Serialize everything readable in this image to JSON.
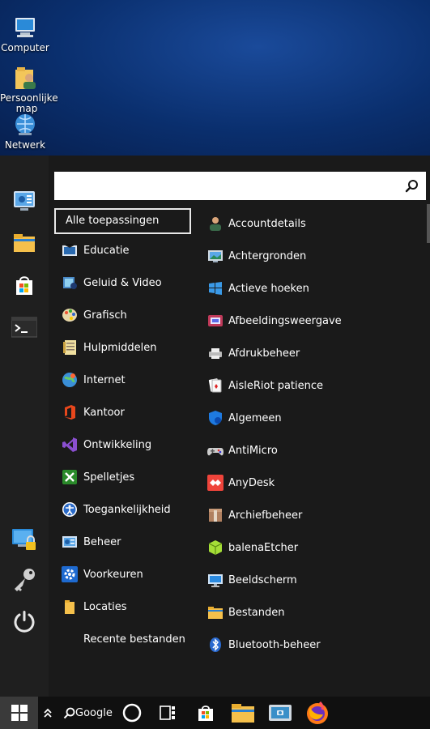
{
  "desktop": {
    "icons": [
      {
        "label": "Computer"
      },
      {
        "label": "Persoonlijke map"
      },
      {
        "label": "Netwerk"
      }
    ]
  },
  "menu": {
    "search": {
      "value": "",
      "placeholder": ""
    },
    "all_apps_label": "Alle toepassingen",
    "categories": [
      {
        "label": "Educatie",
        "icon": "education-icon"
      },
      {
        "label": "Geluid & Video",
        "icon": "sound-video-icon"
      },
      {
        "label": "Grafisch",
        "icon": "graphics-icon"
      },
      {
        "label": "Hulpmiddelen",
        "icon": "accessories-icon"
      },
      {
        "label": "Internet",
        "icon": "internet-icon"
      },
      {
        "label": "Kantoor",
        "icon": "office-icon"
      },
      {
        "label": "Ontwikkeling",
        "icon": "development-icon"
      },
      {
        "label": "Spelletjes",
        "icon": "games-icon"
      },
      {
        "label": "Toegankelijkheid",
        "icon": "accessibility-icon"
      },
      {
        "label": "Beheer",
        "icon": "administration-icon"
      },
      {
        "label": "Voorkeuren",
        "icon": "preferences-icon"
      },
      {
        "label": "Locaties",
        "icon": "places-icon"
      },
      {
        "label": "Recente bestanden",
        "icon": ""
      }
    ],
    "apps": [
      {
        "label": "Accountdetails",
        "icon": "user-account-icon"
      },
      {
        "label": "Achtergronden",
        "icon": "wallpaper-icon"
      },
      {
        "label": "Actieve hoeken",
        "icon": "hot-corners-icon"
      },
      {
        "label": "Afbeeldingsweergave",
        "icon": "image-viewer-icon"
      },
      {
        "label": "Afdrukbeheer",
        "icon": "printer-icon"
      },
      {
        "label": "AisleRiot patience",
        "icon": "cards-icon"
      },
      {
        "label": "Algemeen",
        "icon": "general-settings-icon"
      },
      {
        "label": "AntiMicro",
        "icon": "gamepad-icon"
      },
      {
        "label": "AnyDesk",
        "icon": "anydesk-icon"
      },
      {
        "label": "Archiefbeheer",
        "icon": "archive-icon"
      },
      {
        "label": "balenaEtcher",
        "icon": "etcher-icon"
      },
      {
        "label": "Beeldscherm",
        "icon": "display-icon"
      },
      {
        "label": "Bestanden",
        "icon": "files-icon"
      },
      {
        "label": "Bluetooth-beheer",
        "icon": "bluetooth-icon"
      }
    ]
  },
  "taskbar": {
    "google_label": "Google"
  }
}
